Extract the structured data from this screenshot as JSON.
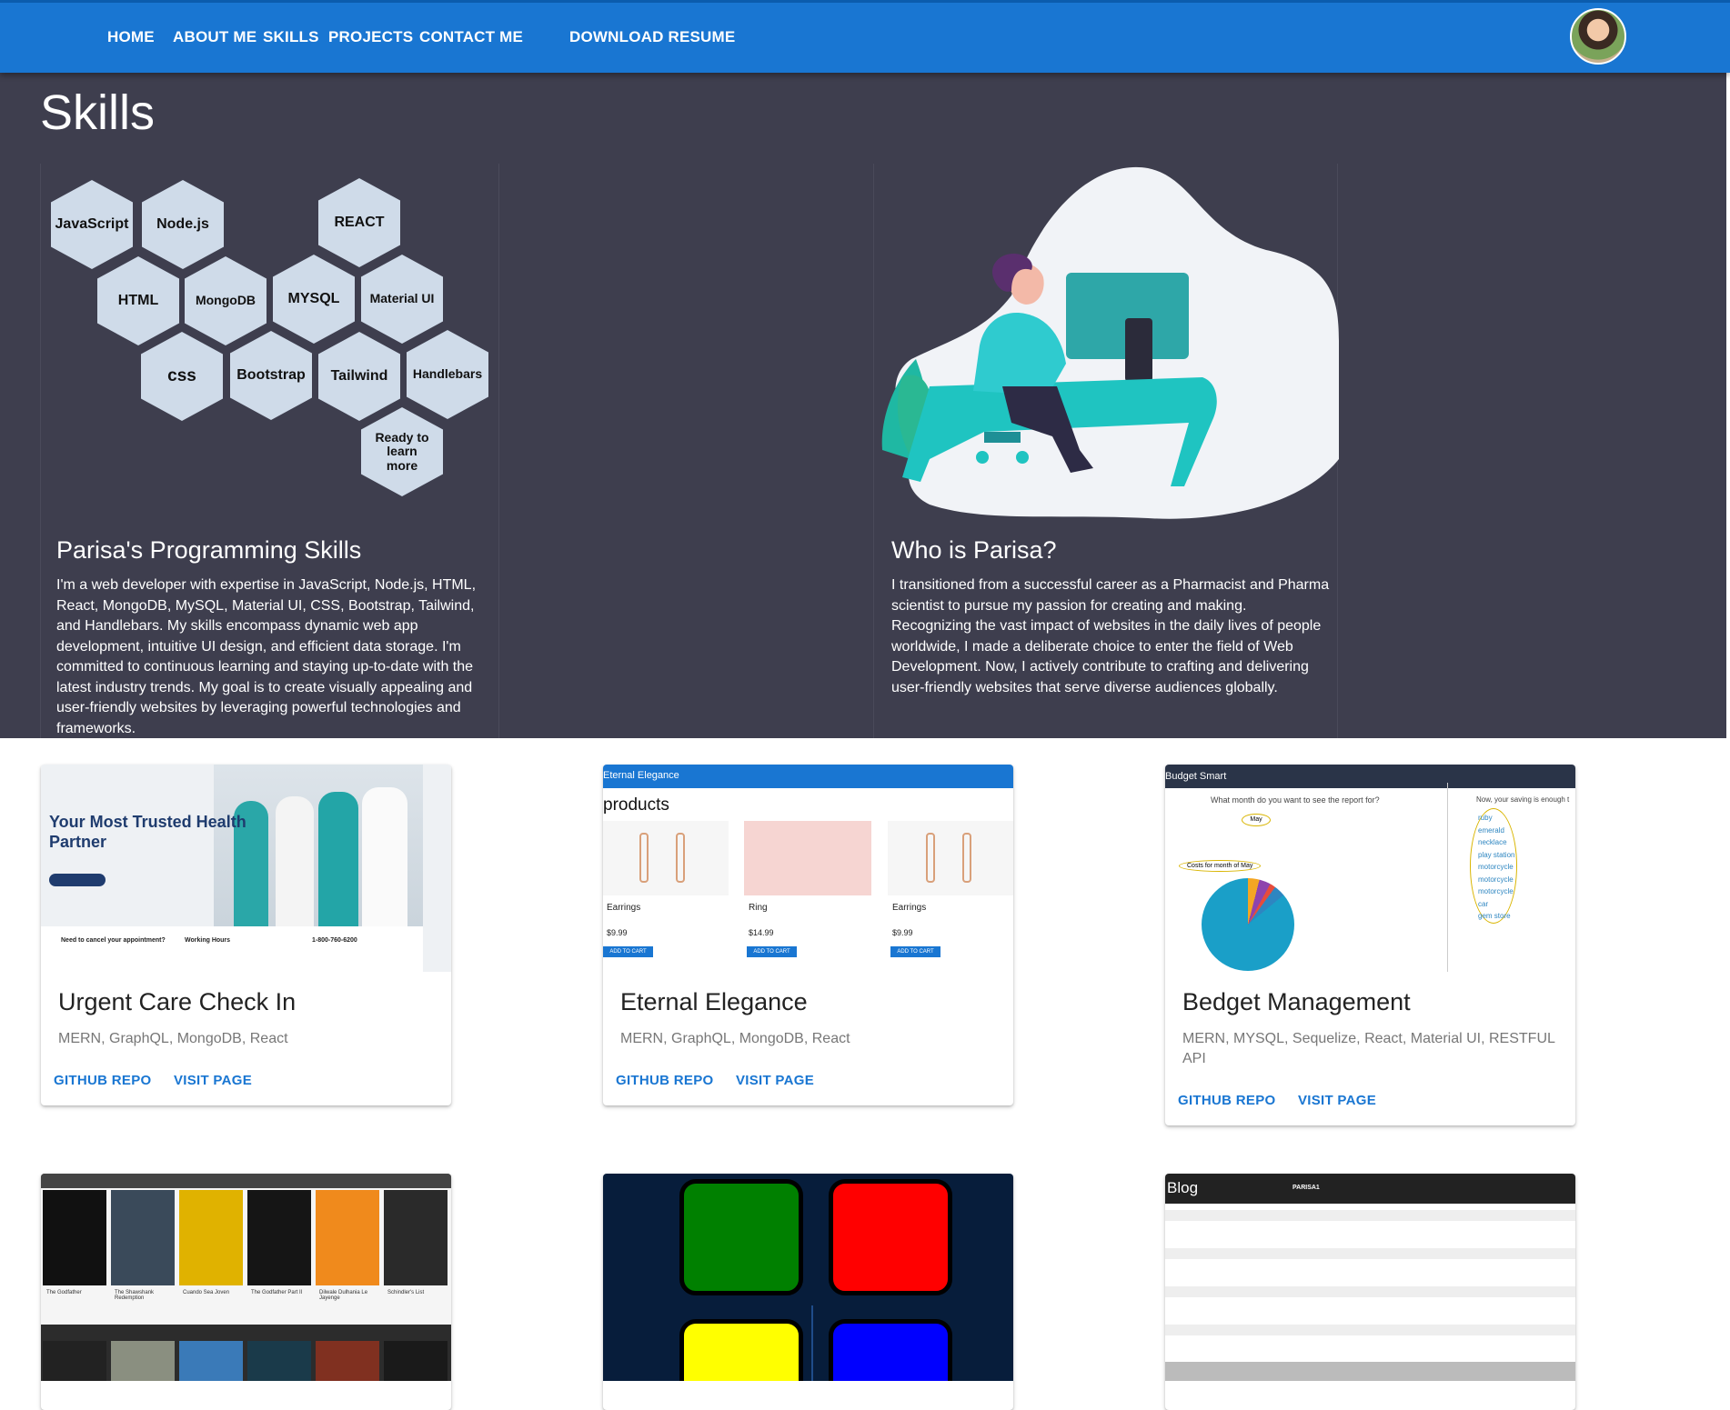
{
  "nav": {
    "links": [
      "HOME",
      "ABOUT ME",
      "SKILLS",
      "PROJECTS",
      "CONTACT ME",
      "DOWNLOAD RESUME"
    ]
  },
  "skills": {
    "title": "Skills",
    "hexes": [
      "JavaScript",
      "Node.js",
      "REACT",
      "HTML",
      "MongoDB",
      "MYSQL",
      "Material UI",
      "css",
      "Bootstrap",
      "Tailwind",
      "Handlebars",
      "Ready to learn more"
    ],
    "programming": {
      "heading": "Parisa's Programming Skills",
      "text": "I'm a web developer with expertise in JavaScript, Node.js, HTML, React, MongoDB, MySQL, Material UI, CSS, Bootstrap, Tailwind, and Handlebars. My skills encompass dynamic web app development, intuitive UI design, and efficient data storage. I'm committed to continuous learning and staying up-to-date with the latest industry trends. My goal is to create visually appealing and user-friendly websites by leveraging powerful technologies and frameworks."
    },
    "who": {
      "heading": "Who is Parisa?",
      "text": "I transitioned from a successful career as a Pharmacist and Pharma scientist to pursue my passion for creating and making. Recognizing the vast impact of websites in the daily lives of people worldwide, I made a deliberate choice to enter the field of Web Development. Now, I actively contribute to crafting and delivering user-friendly websites that serve diverse audiences globally."
    }
  },
  "projects": [
    {
      "title": "Urgent Care Check In",
      "tech": "MERN, GraphQL, MongoDB, React",
      "github": "GITHUB REPO",
      "visit": "VISIT PAGE",
      "screenshot_text": {
        "headline": "Your Most Trusted Health Partner",
        "phone": "1-800-760-6200",
        "cancel": "Need to cancel your appointment?",
        "hours": "Working Hours"
      }
    },
    {
      "title": "Eternal Elegance",
      "tech": "MERN, GraphQL, MongoDB, React",
      "github": "GITHUB REPO",
      "visit": "VISIT PAGE",
      "screenshot_text": {
        "brand": "Eternal Elegance",
        "heading": "products",
        "items": [
          {
            "name": "Earrings",
            "price": "$9.99"
          },
          {
            "name": "Ring",
            "price": "$14.99"
          },
          {
            "name": "Earrings",
            "price": "$9.99"
          }
        ],
        "cart": "ADD TO CART"
      }
    },
    {
      "title": "Bedget Management",
      "tech": "MERN, MYSQL, Sequelize, React, Material UI, RESTFUL API",
      "github": "GITHUB REPO",
      "visit": "VISIT PAGE",
      "screenshot_text": {
        "brand": "Budget Smart",
        "question": "What month do you want to see the report for?",
        "month": "May",
        "costs": "Costs for month of May",
        "saving": "Now, your saving is enough t",
        "list": [
          "ruby",
          "emerald",
          "necklace",
          "play station",
          "motorcycle",
          "motorcycle",
          "motorcycle",
          "car",
          "gem store"
        ]
      }
    },
    {
      "screenshot_text": {
        "movies": [
          "The Godfather",
          "The Shawshank Redemption",
          "Cuando Sea Joven",
          "The Godfather Part II",
          "Dilwale Dulhania Le Jayenge",
          "Schindler's List"
        ]
      }
    },
    {
      "screenshot_text": {}
    },
    {
      "screenshot_text": {
        "brand": "Blog",
        "user": "PARISA1"
      }
    }
  ],
  "colors": {
    "nav": "#1976d2",
    "skills_bg": "#3e3e4e",
    "hex": "#cfdbe9",
    "link": "#1976d2"
  }
}
